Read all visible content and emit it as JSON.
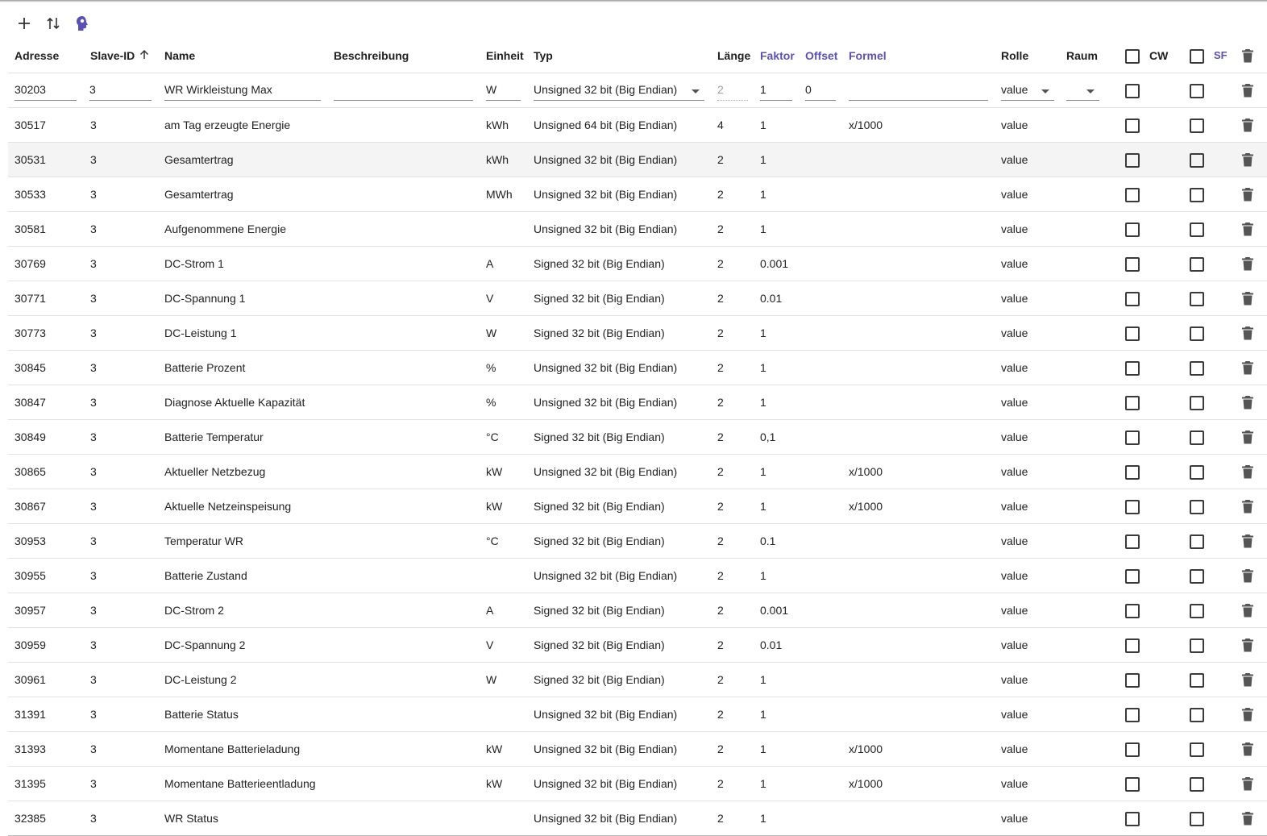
{
  "toolbar": {
    "add_icon": "plus-icon",
    "sort_icon": "swap-vertical-icon",
    "import_icon": "head-icon"
  },
  "colors": {
    "accent": "#5a51b8",
    "row_highlight": "#f4f4f4"
  },
  "columns": {
    "address": "Adresse",
    "slave_id": "Slave-ID",
    "name": "Name",
    "description": "Beschreibung",
    "unit": "Einheit",
    "type": "Typ",
    "length": "Länge",
    "factor": "Faktor",
    "offset": "Offset",
    "formula": "Formel",
    "role": "Rolle",
    "room": "Raum",
    "cw": "CW",
    "sf": "SF"
  },
  "edit_row": {
    "address": "30203",
    "slave_id": "3",
    "name": "WR Wirkleistung Max",
    "description": "",
    "unit": "W",
    "type": "Unsigned 32 bit (Big Endian)",
    "length": "2",
    "factor": "1",
    "offset": "0",
    "formula": "",
    "role": "value",
    "room": ""
  },
  "rows": [
    {
      "address": "30517",
      "slave_id": "3",
      "name": "am Tag erzeugte Energie",
      "unit": "kWh",
      "type": "Unsigned 64 bit (Big Endian)",
      "length": "4",
      "factor": "1",
      "formula": "x/1000",
      "role": "value"
    },
    {
      "address": "30531",
      "slave_id": "3",
      "name": "Gesamtertrag",
      "unit": "kWh",
      "type": "Unsigned 32 bit (Big Endian)",
      "length": "2",
      "factor": "1",
      "formula": "",
      "role": "value"
    },
    {
      "address": "30533",
      "slave_id": "3",
      "name": "Gesamtertrag",
      "unit": "MWh",
      "type": "Unsigned 32 bit (Big Endian)",
      "length": "2",
      "factor": "1",
      "formula": "",
      "role": "value"
    },
    {
      "address": "30581",
      "slave_id": "3",
      "name": "Aufgenommene Energie",
      "unit": "",
      "type": "Unsigned 32 bit (Big Endian)",
      "length": "2",
      "factor": "1",
      "formula": "",
      "role": "value"
    },
    {
      "address": "30769",
      "slave_id": "3",
      "name": "DC-Strom 1",
      "unit": "A",
      "type": "Signed 32 bit (Big Endian)",
      "length": "2",
      "factor": "0.001",
      "formula": "",
      "role": "value"
    },
    {
      "address": "30771",
      "slave_id": "3",
      "name": "DC-Spannung 1",
      "unit": "V",
      "type": "Signed 32 bit (Big Endian)",
      "length": "2",
      "factor": "0.01",
      "formula": "",
      "role": "value"
    },
    {
      "address": "30773",
      "slave_id": "3",
      "name": "DC-Leistung 1",
      "unit": "W",
      "type": "Signed 32 bit (Big Endian)",
      "length": "2",
      "factor": "1",
      "formula": "",
      "role": "value"
    },
    {
      "address": "30845",
      "slave_id": "3",
      "name": "Batterie Prozent",
      "unit": "%",
      "type": "Unsigned 32 bit (Big Endian)",
      "length": "2",
      "factor": "1",
      "formula": "",
      "role": "value"
    },
    {
      "address": "30847",
      "slave_id": "3",
      "name": "Diagnose Aktuelle Kapazität",
      "unit": "%",
      "type": "Unsigned 32 bit (Big Endian)",
      "length": "2",
      "factor": "1",
      "formula": "",
      "role": "value"
    },
    {
      "address": "30849",
      "slave_id": "3",
      "name": "Batterie Temperatur",
      "unit": "°C",
      "type": "Signed 32 bit (Big Endian)",
      "length": "2",
      "factor": "0,1",
      "formula": "",
      "role": "value"
    },
    {
      "address": "30865",
      "slave_id": "3",
      "name": "Aktueller Netzbezug",
      "unit": "kW",
      "type": "Unsigned 32 bit (Big Endian)",
      "length": "2",
      "factor": "1",
      "formula": "x/1000",
      "role": "value"
    },
    {
      "address": "30867",
      "slave_id": "3",
      "name": "Aktuelle Netzeinspeisung",
      "unit": "kW",
      "type": "Signed 32 bit (Big Endian)",
      "length": "2",
      "factor": "1",
      "formula": "x/1000",
      "role": "value"
    },
    {
      "address": "30953",
      "slave_id": "3",
      "name": "Temperatur WR",
      "unit": "°C",
      "type": "Signed 32 bit (Big Endian)",
      "length": "2",
      "factor": "0.1",
      "formula": "",
      "role": "value"
    },
    {
      "address": "30955",
      "slave_id": "3",
      "name": "Batterie Zustand",
      "unit": "",
      "type": "Unsigned 32 bit (Big Endian)",
      "length": "2",
      "factor": "1",
      "formula": "",
      "role": "value"
    },
    {
      "address": "30957",
      "slave_id": "3",
      "name": "DC-Strom 2",
      "unit": "A",
      "type": "Signed 32 bit (Big Endian)",
      "length": "2",
      "factor": "0.001",
      "formula": "",
      "role": "value"
    },
    {
      "address": "30959",
      "slave_id": "3",
      "name": "DC-Spannung 2",
      "unit": "V",
      "type": "Signed 32 bit (Big Endian)",
      "length": "2",
      "factor": "0.01",
      "formula": "",
      "role": "value"
    },
    {
      "address": "30961",
      "slave_id": "3",
      "name": "DC-Leistung 2",
      "unit": "W",
      "type": "Signed 32 bit (Big Endian)",
      "length": "2",
      "factor": "1",
      "formula": "",
      "role": "value"
    },
    {
      "address": "31391",
      "slave_id": "3",
      "name": "Batterie Status",
      "unit": "",
      "type": "Unsigned 32 bit (Big Endian)",
      "length": "2",
      "factor": "1",
      "formula": "",
      "role": "value"
    },
    {
      "address": "31393",
      "slave_id": "3",
      "name": "Momentane Batterieladung",
      "unit": "kW",
      "type": "Unsigned 32 bit (Big Endian)",
      "length": "2",
      "factor": "1",
      "formula": "x/1000",
      "role": "value"
    },
    {
      "address": "31395",
      "slave_id": "3",
      "name": "Momentane Batterieentladung",
      "unit": "kW",
      "type": "Unsigned 32 bit (Big Endian)",
      "length": "2",
      "factor": "1",
      "formula": "x/1000",
      "role": "value"
    },
    {
      "address": "32385",
      "slave_id": "3",
      "name": "WR Status",
      "unit": "",
      "type": "Unsigned 32 bit (Big Endian)",
      "length": "2",
      "factor": "1",
      "formula": "",
      "role": "value"
    }
  ]
}
